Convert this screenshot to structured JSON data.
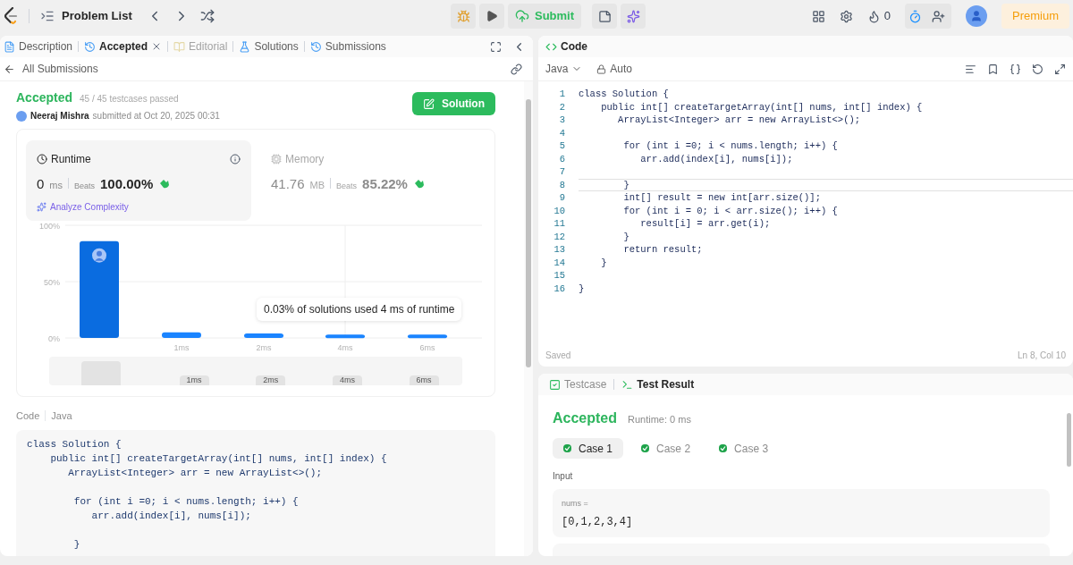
{
  "topbar": {
    "title": "Problem List",
    "submit": "Submit",
    "streak": "0",
    "premium": "Premium"
  },
  "left_tabs": [
    {
      "label": "Description",
      "kind": "description",
      "selected": false,
      "disabled": false,
      "closable": false
    },
    {
      "label": "Accepted",
      "kind": "history",
      "selected": true,
      "disabled": false,
      "closable": true
    },
    {
      "label": "Editorial",
      "kind": "book",
      "selected": false,
      "disabled": true,
      "closable": false
    },
    {
      "label": "Solutions",
      "kind": "flask",
      "selected": false,
      "disabled": false,
      "closable": false
    },
    {
      "label": "Submissions",
      "kind": "history",
      "selected": false,
      "disabled": false,
      "closable": false
    }
  ],
  "submission": {
    "back": "All Submissions",
    "status": "Accepted",
    "testcases": "45 / 45 testcases passed",
    "user": "Neeraj Mishra",
    "submitted": "submitted at Oct 20, 2025 00:31",
    "solution_button": "Solution"
  },
  "stats": [
    {
      "kind": "runtime",
      "label": "Runtime",
      "value": "0",
      "unit": "ms",
      "beats_label": "Beats",
      "beats": "100.00%",
      "selected": true,
      "analyze": "Analyze Complexity"
    },
    {
      "kind": "memory",
      "label": "Memory",
      "value": "41.76",
      "unit": "MB",
      "beats_label": "Beats",
      "beats": "85.22%",
      "selected": false
    }
  ],
  "chart": {
    "chart_data": {
      "type": "bar",
      "categories": [
        null,
        "1ms",
        "2ms",
        "4ms",
        "6ms"
      ],
      "values": [
        86,
        5,
        4,
        3,
        3
      ],
      "yticks": [
        {
          "value": 0,
          "label": "0%"
        },
        {
          "value": 50,
          "label": "50%"
        },
        {
          "value": 100,
          "label": "100%"
        }
      ],
      "ylim": [
        0,
        100
      ]
    },
    "tooltip": "0.03% of solutions used 4 ms of runtime",
    "range_labels": [
      "1ms",
      "2ms",
      "4ms",
      "6ms"
    ]
  },
  "code_section": {
    "label": "Code",
    "language": "Java",
    "lines": [
      {
        "text": "class Solution {"
      },
      {
        "text": "    public int[] createTargetArray(int[] nums, int[] index) {"
      },
      {
        "text": "       ArrayList<Integer> arr = new ArrayList<>();"
      },
      {
        "kind": "blank"
      },
      {
        "text": "        for (int i =0; i < nums.length; i++) {"
      },
      {
        "text": "           arr.add(index[i], nums[i]);"
      },
      {
        "kind": "blank"
      },
      {
        "text": "        }"
      }
    ]
  },
  "editor": {
    "title": "Code",
    "language": "Java",
    "mode": "Auto",
    "status": "Saved",
    "cursor": "Ln 8, Col 10",
    "lines": [
      {
        "number": "1",
        "text": "class Solution {",
        "current": false
      },
      {
        "number": "2",
        "text": "    public int[] createTargetArray(int[] nums, int[] index) {",
        "current": false
      },
      {
        "number": "3",
        "text": "       ArrayList<Integer> arr = new ArrayList<>();",
        "current": false
      },
      {
        "number": "4",
        "current": false
      },
      {
        "number": "5",
        "text": "        for (int i =0; i < nums.length; i++) {",
        "current": false
      },
      {
        "number": "6",
        "text": "           arr.add(index[i], nums[i]);",
        "current": false
      },
      {
        "number": "7",
        "current": false
      },
      {
        "number": "8",
        "text": "        }",
        "current": true
      },
      {
        "number": "9",
        "text": "        int[] result = new int[arr.size()];",
        "current": false
      },
      {
        "number": "10",
        "text": "        for (int i = 0; i < arr.size(); i++) {",
        "current": false
      },
      {
        "number": "11",
        "text": "           result[i] = arr.get(i);",
        "current": false
      },
      {
        "number": "12",
        "text": "        }",
        "current": false
      },
      {
        "number": "13",
        "text": "        return result;",
        "current": false
      },
      {
        "number": "14",
        "text": "    }",
        "current": false
      },
      {
        "number": "15",
        "current": false
      },
      {
        "number": "16",
        "text": "}",
        "current": false
      }
    ]
  },
  "results": {
    "tabs": [
      {
        "label": "Testcase",
        "kind": "testcase",
        "selected": false
      },
      {
        "label": "Test Result",
        "kind": "terminal",
        "selected": true
      }
    ],
    "status": "Accepted",
    "runtime": "Runtime: 0 ms",
    "cases": [
      {
        "label": "Case 1",
        "selected": true,
        "passed": true
      },
      {
        "label": "Case 2",
        "selected": false,
        "passed": true
      },
      {
        "label": "Case 3",
        "selected": false,
        "passed": true
      }
    ],
    "input_label": "Input",
    "inputs": [
      {
        "name": "nums =",
        "value": "[0,1,2,3,4]"
      }
    ]
  }
}
